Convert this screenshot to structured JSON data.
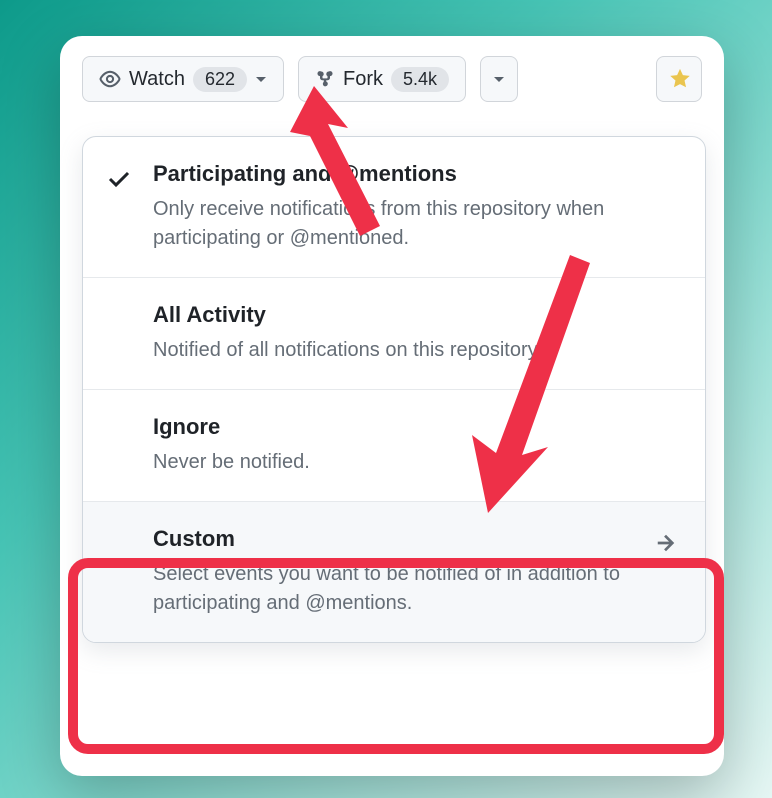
{
  "toolbar": {
    "watch": {
      "label": "Watch",
      "count": "622"
    },
    "fork": {
      "label": "Fork",
      "count": "5.4k"
    }
  },
  "menu": {
    "participating": {
      "title": "Participating and @mentions",
      "desc": "Only receive notifications from this repository when participating or @mentioned."
    },
    "all": {
      "title": "All Activity",
      "desc": "Notified of all notifications on this repository."
    },
    "ignore": {
      "title": "Ignore",
      "desc": "Never be notified."
    },
    "custom": {
      "title": "Custom",
      "desc": "Select events you want to be notified of in addition to participating and @mentions."
    }
  }
}
